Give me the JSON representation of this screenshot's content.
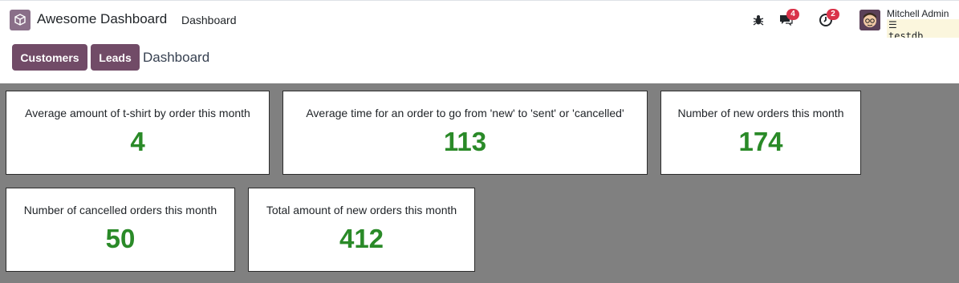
{
  "navbar": {
    "app_name": "Awesome Dashboard",
    "menu_item": "Dashboard",
    "messages_count": "4",
    "activities_count": "2",
    "user_name": "Mitchell Admin",
    "db_name": "testdb"
  },
  "control_panel": {
    "customers_label": "Customers",
    "leads_label": "Leads",
    "title": "Dashboard"
  },
  "cards": [
    {
      "title": "Average amount of t-shirt by order this month",
      "value": "4"
    },
    {
      "title": "Average time for an order to go from 'new' to 'sent' or 'cancelled'",
      "value": "113"
    },
    {
      "title": "Number of new orders this month",
      "value": "174"
    },
    {
      "title": "Number of cancelled orders this month",
      "value": "50"
    },
    {
      "title": "Total amount of new orders this month",
      "value": "412"
    }
  ],
  "colors": {
    "brand": "#714b67",
    "value_green": "#2a8a28",
    "badge_red": "#d9334a",
    "background_gray": "#808080"
  }
}
